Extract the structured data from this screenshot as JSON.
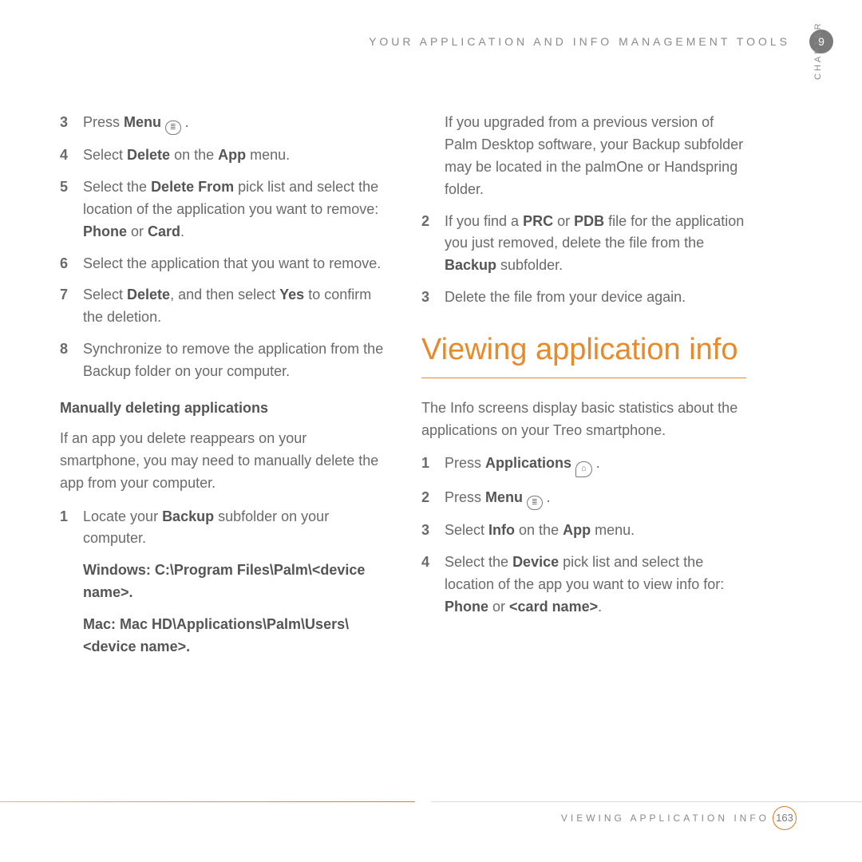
{
  "header": {
    "running": "YOUR APPLICATION AND INFO MANAGEMENT TOOLS",
    "chapter_number": "9",
    "chapter_word": "CHAPTER"
  },
  "left": {
    "steps_a": [
      {
        "n": "3",
        "pre": "Press ",
        "bold": "Menu",
        "post": " ",
        "icon": "menu"
      },
      {
        "n": "4",
        "segments": [
          {
            "t": "Select "
          },
          {
            "t": "Delete",
            "b": 1
          },
          {
            "t": " on the "
          },
          {
            "t": "App",
            "b": 1
          },
          {
            "t": " menu."
          }
        ]
      },
      {
        "n": "5",
        "segments": [
          {
            "t": "Select the "
          },
          {
            "t": "Delete From",
            "b": 1
          },
          {
            "t": " pick list and select the location of the application you want to remove: "
          },
          {
            "t": "Phone",
            "b": 1
          },
          {
            "t": " or "
          },
          {
            "t": "Card",
            "b": 1
          },
          {
            "t": "."
          }
        ]
      },
      {
        "n": "6",
        "segments": [
          {
            "t": "Select the application that you want to remove."
          }
        ]
      },
      {
        "n": "7",
        "segments": [
          {
            "t": "Select "
          },
          {
            "t": "Delete",
            "b": 1
          },
          {
            "t": ", and then select "
          },
          {
            "t": "Yes",
            "b": 1
          },
          {
            "t": " to confirm the deletion."
          }
        ]
      },
      {
        "n": "8",
        "segments": [
          {
            "t": "Synchronize to remove the application from the Backup folder on your computer."
          }
        ]
      }
    ],
    "subhead": "Manually deleting applications",
    "para1": "If an app you delete reappears on your smartphone, you may need to manually delete the app from your computer.",
    "steps_b": [
      {
        "n": "1",
        "segments": [
          {
            "t": "Locate your "
          },
          {
            "t": "Backup",
            "b": 1
          },
          {
            "t": " subfolder on your computer."
          }
        ]
      }
    ],
    "paths_win": "Windows: C:\\Program Files\\Palm\\<device name>.",
    "paths_mac": "Mac: Mac HD\\Applications\\Palm\\Users\\<device name>."
  },
  "right": {
    "cont": "If you upgraded from a previous version of Palm Desktop software, your Backup subfolder may be located in the palmOne or Handspring folder.",
    "steps_c": [
      {
        "n": "2",
        "segments": [
          {
            "t": "If you find a "
          },
          {
            "t": "PRC",
            "b": 1
          },
          {
            "t": " or "
          },
          {
            "t": "PDB",
            "b": 1
          },
          {
            "t": " file for the application you just removed, delete the file from the "
          },
          {
            "t": "Backup",
            "b": 1
          },
          {
            "t": " subfolder."
          }
        ]
      },
      {
        "n": "3",
        "segments": [
          {
            "t": "Delete the file from your device again."
          }
        ]
      }
    ],
    "h2": "Viewing application info",
    "para2": "The Info screens display basic statistics about the applications on your Treo smartphone.",
    "steps_d": [
      {
        "n": "1",
        "pre": "Press ",
        "bold": "Applications",
        "post": " ",
        "icon": "home"
      },
      {
        "n": "2",
        "pre": "Press ",
        "bold": "Menu",
        "post": " ",
        "icon": "menu"
      },
      {
        "n": "3",
        "segments": [
          {
            "t": "Select "
          },
          {
            "t": "Info",
            "b": 1
          },
          {
            "t": " on the "
          },
          {
            "t": "App",
            "b": 1
          },
          {
            "t": " menu."
          }
        ]
      },
      {
        "n": "4",
        "segments": [
          {
            "t": "Select the "
          },
          {
            "t": "Device",
            "b": 1
          },
          {
            "t": " pick list and select the location of the app you want to view info for: "
          },
          {
            "t": "Phone",
            "b": 1
          },
          {
            "t": " or "
          },
          {
            "t": "<card name>",
            "b": 1
          },
          {
            "t": "."
          }
        ]
      }
    ]
  },
  "footer": {
    "text": "VIEWING APPLICATION INFO",
    "page": "163"
  },
  "icons": {
    "menu_glyph": "≣",
    "home_glyph": "⌂"
  }
}
